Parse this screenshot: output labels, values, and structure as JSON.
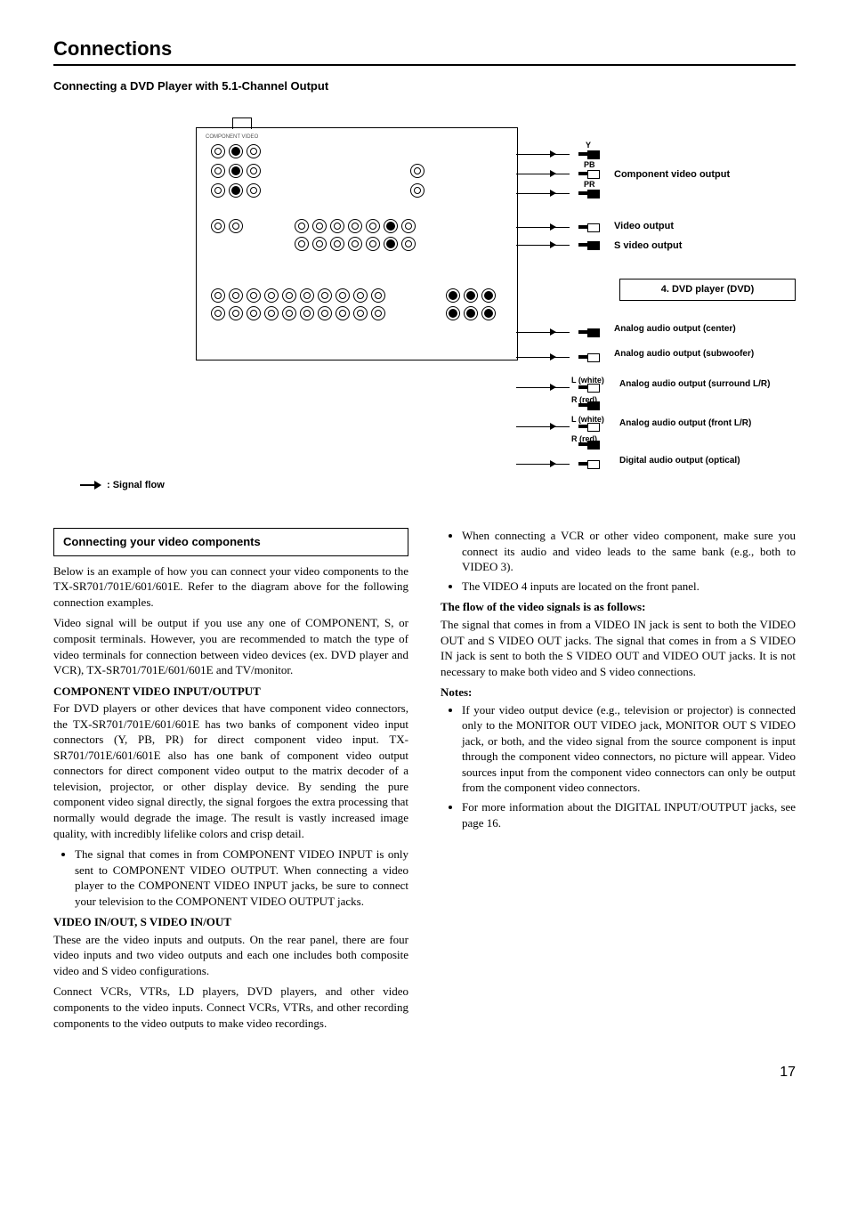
{
  "title": "Connections",
  "section": "Connecting a DVD Player with 5.1-Channel Output",
  "diagram": {
    "signal_flow_label": ": Signal flow",
    "dvd_box": "4. DVD player (DVD)",
    "labels": {
      "component_video_output": "Component video output",
      "video_output": "Video output",
      "s_video_output": "S video output",
      "analog_center": "Analog audio output (center)",
      "analog_sub": "Analog audio output (subwoofer)",
      "analog_surround": "Analog audio output (surround L/R)",
      "analog_front": "Analog audio output (front L/R)",
      "digital_optical": "Digital audio output (optical)",
      "l_white": "L (white)",
      "r_red": "R (red)",
      "y": "Y",
      "pb": "PB",
      "pr": "PR",
      "component_video_header": "COMPONENT VIDEO"
    }
  },
  "left": {
    "box_heading": "Connecting your video components",
    "intro": "Below is an example of how you can connect your video components to the TX-SR701/701E/601/601E. Refer to the diagram above for the following connection examples.",
    "intro2": "Video signal will be output if you use any one of COMPONENT, S, or composit terminals. However, you are recommended to match the type of video terminals for connection between video devices (ex. DVD player and VCR), TX-SR701/701E/601/601E and TV/monitor.",
    "h1": "COMPONENT VIDEO INPUT/OUTPUT",
    "p1": "For DVD players or other devices that have component video connectors, the TX-SR701/701E/601/601E has two banks of component video input connectors (Y, PB, PR) for direct component video input. TX-SR701/701E/601/601E also has one bank of component video output connectors for direct component video output to the matrix decoder of a television, projector, or other display device. By sending the pure component video signal directly, the signal forgoes the extra processing that normally would degrade the image. The result is vastly increased image quality, with incredibly lifelike colors and crisp detail.",
    "b1": "The signal that comes in from COMPONENT VIDEO INPUT is only sent to COMPONENT VIDEO OUTPUT. When connecting a video player to the COMPONENT VIDEO INPUT jacks, be sure to connect your television to the COMPONENT VIDEO OUTPUT jacks.",
    "h2": "VIDEO IN/OUT, S VIDEO IN/OUT",
    "p2": "These are the video inputs and outputs. On the rear panel, there are four video inputs and two video outputs and each one includes both composite video and S video configurations.",
    "p3": "Connect VCRs, VTRs, LD players, DVD players, and other video components to the video inputs. Connect VCRs, VTRs, and other recording components to the video outputs to make video recordings."
  },
  "right": {
    "b1": "When connecting a VCR or other video component, make sure you connect its audio and video leads to the same bank (e.g., both to VIDEO 3).",
    "b2": "The VIDEO 4 inputs are located on the front panel.",
    "flow_head": "The flow of the video signals is as follows:",
    "flow_body": "The signal that comes in from a VIDEO IN jack is sent to both the VIDEO OUT and S VIDEO OUT jacks. The signal that comes in from a S VIDEO IN jack is sent to both the S VIDEO OUT and VIDEO OUT jacks. It is not necessary to make both video and S video connections.",
    "notes_head": "Notes:",
    "n1": "If your video output device (e.g., television or projector) is connected only to the MONITOR OUT VIDEO jack, MONITOR OUT S VIDEO jack, or both, and the video signal from the source component is input through the component video connectors, no picture will appear. Video sources input from the component video connectors can only be output from the component video connectors.",
    "n2": "For more information about the DIGITAL INPUT/OUTPUT jacks, see page 16."
  },
  "page_number": "17"
}
